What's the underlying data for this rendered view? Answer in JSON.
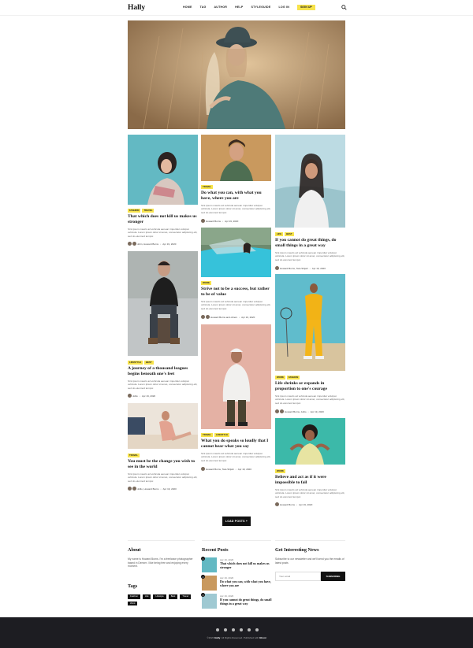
{
  "header": {
    "logo": "Hally",
    "nav": [
      "HOME",
      "TAG",
      "AUTHOR",
      "HELP",
      "STYLEGUIDE",
      "LOG IN"
    ],
    "signup": "SIGN UP"
  },
  "posts": [
    {
      "tags": [
        "FASHION",
        "TRAVEL"
      ],
      "title": "That which does not kill us makes us stronger",
      "excerpt": "Sint ipsum mauris ad vehicula aenean imperdiet volutpat vehicula. Lorem ipsum dolor sit amet, consectetur adipiscing elit, sed do eiusmod tempor.",
      "authors": "John, Howard Burns",
      "date": "Apr 19, 2020"
    },
    {
      "tags": [
        "TRAVEL"
      ],
      "title": "Do what you can, with what you have, where you are",
      "excerpt": "Sint ipsum mauris ad vehicula aenean imperdiet volutpat vehicula. Lorem ipsum dolor sit amet, consectetur adipiscing elit, sed do eiusmod tempor.",
      "authors": "Howard Burns",
      "date": "Apr 19, 2020"
    },
    {
      "tags": [
        "LIFE",
        "BEST"
      ],
      "title": "If you cannot do great things, do small things in a great way",
      "excerpt": "Sint ipsum mauris ad vehicula aenean imperdiet volutpat vehicula. Lorem ipsum dolor sit amet, consectetur adipiscing elit, sed do eiusmod tempor.",
      "authors": "Howard Burns, Tara Shijah",
      "date": "Apr 19, 2020"
    },
    {
      "tags": [
        "LIFESTYLE",
        "BEST"
      ],
      "title": "A journey of a thousand leagues begins beneath one's feet",
      "excerpt": "Sint ipsum mauris ad vehicula aenean imperdiet volutpat vehicula. Lorem ipsum dolor sit amet, consectetur adipiscing elit, sed do eiusmod tempor.",
      "authors": "Jollio",
      "date": "Apr 19, 2020"
    },
    {
      "tags": [
        "WORK"
      ],
      "title": "Strive not to be a success, but rather to be of value",
      "excerpt": "Sint ipsum mauris ad vehicula aenean imperdiet volutpat vehicula. Lorem ipsum dolor sit amet, consectetur adipiscing elit, sed do eiusmod tempor.",
      "authors": "Howard Burns and others",
      "date": "Apr 19, 2020"
    },
    {
      "tags": [
        "WORK",
        "FASHION"
      ],
      "title": "Life shrinks or expands in proportion to one's courage",
      "excerpt": "Sint ipsum mauris ad vehicula aenean imperdiet volutpat vehicula. Lorem ipsum dolor sit amet, consectetur adipiscing elit, sed do eiusmod tempor.",
      "authors": "Howard Burns, Jollio",
      "date": "Apr 19, 2020"
    },
    {
      "tags": [
        "TRAVEL"
      ],
      "title": "You must be the change you wish to see in the world",
      "excerpt": "Sint ipsum mauris ad vehicula aenean imperdiet volutpat vehicula. Lorem ipsum dolor sit amet, consectetur adipiscing elit, sed do eiusmod tempor.",
      "authors": "Jollio, Howard Burns",
      "date": "Apr 19, 2020"
    },
    {
      "tags": [
        "TRAVEL",
        "LIFESTYLE"
      ],
      "title": "What you do speaks so loudly that I cannot hear what you say",
      "excerpt": "Sint ipsum mauris ad vehicula aenean imperdiet volutpat vehicula. Lorem ipsum dolor sit amet, consectetur adipiscing elit, sed do eiusmod tempor.",
      "authors": "Howard Burns, Tara Shijah",
      "date": "Apr 19, 2020"
    },
    {
      "tags": [
        "WORK"
      ],
      "title": "Believe and act as if it were impossible to fail",
      "excerpt": "Sint ipsum mauris ad vehicula aenean imperdiet volutpat vehicula. Lorem ipsum dolor sit amet, consectetur adipiscing elit, sed do eiusmod tempor.",
      "authors": "Howard Burns",
      "date": "Apr 19, 2020"
    }
  ],
  "load_more": "LOAD POSTS +",
  "about": {
    "title": "About",
    "text": "My name is Howard Burns. I'm a freelance photographer based in Denver. I like being free and enjoying every moment."
  },
  "tags_widget": {
    "title": "Tags",
    "tags": [
      "Fashion",
      "Life",
      "Lifestyle",
      "Best",
      "Travel",
      "Work"
    ]
  },
  "recent": {
    "title": "Recent Posts",
    "items": [
      {
        "num": "1",
        "date": "Apr 19, 2020",
        "title": "That which does not kill us makes us stronger"
      },
      {
        "num": "2",
        "date": "Apr 19, 2020",
        "title": "Do what you can, with what you have, where you are"
      },
      {
        "num": "3",
        "date": "Apr 19, 2020",
        "title": "If you cannot do great things, do small things in a great way"
      }
    ]
  },
  "newsletter": {
    "title": "Get Interesting News",
    "text": "Subscribe to our newsletter and we'll send you the emails of latest posts",
    "placeholder": "Your email",
    "button": "SUBSCRIBE"
  },
  "footer": {
    "copyright_pre": "©2020",
    "brand": "Hally",
    "copyright_mid": ". All Rights Reserved. Published with",
    "platform": "Ghost"
  },
  "colors": {
    "accent": "#f7e34b",
    "footer": "#1d1d22",
    "button": "#111111"
  },
  "icons": [
    "search-icon",
    "twitter-icon",
    "facebook-icon",
    "instagram-icon",
    "pinterest-icon",
    "rss-icon",
    "youtube-icon"
  ]
}
